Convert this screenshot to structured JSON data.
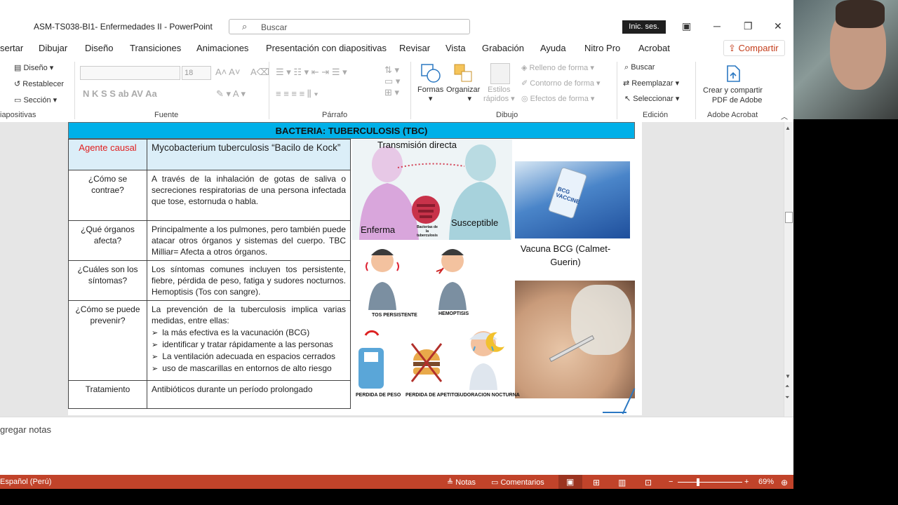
{
  "window": {
    "title": "ASM-TS038-BI1- Enfermedades II  -  PowerPoint",
    "search_placeholder": "Buscar",
    "signin": "Inic. ses."
  },
  "tabs": [
    "sertar",
    "Dibujar",
    "Diseño",
    "Transiciones",
    "Animaciones",
    "Presentación con diapositivas",
    "Revisar",
    "Vista",
    "Grabación",
    "Ayuda",
    "Nitro Pro",
    "Acrobat"
  ],
  "share_label": "Compartir",
  "ribbon": {
    "slides": {
      "design": "Diseño",
      "reset": "Restablecer",
      "section": "Sección",
      "group": "iapositivas"
    },
    "font": {
      "size": "18",
      "group": "Fuente"
    },
    "paragraph": {
      "group": "Párrafo"
    },
    "drawing": {
      "shapes": "Formas",
      "arrange": "Organizar",
      "quick1": "Estilos",
      "quick2": "rápidos",
      "fill": "Relleno de forma",
      "outline": "Contorno de forma",
      "effects": "Efectos de forma",
      "group": "Dibujo"
    },
    "editing": {
      "find": "Buscar",
      "replace": "Reemplazar",
      "select": "Seleccionar",
      "group": "Edición"
    },
    "adobe": {
      "l1": "Crear y compartir",
      "l2": "PDF de Adobe",
      "group": "Adobe Acrobat"
    }
  },
  "slide": {
    "banner": "BACTERIA: TUBERCULOSIS (TBC)",
    "rows": [
      {
        "q": "Agente causal",
        "a": "Mycobacterium tuberculosis “Bacilo de Kock”"
      },
      {
        "q": "¿Cómo se contrae?",
        "a": "A través de la inhalación de gotas de saliva o secreciones respiratorias de una persona infectada que tose, estornuda o habla."
      },
      {
        "q": "¿Qué órganos afecta?",
        "a": "Principalmente a los pulmones, pero también puede atacar otros órganos y sistemas del cuerpo. TBC Milliar= Afecta a otros órganos."
      },
      {
        "q": "¿Cuáles son los síntomas?",
        "a": "Los síntomas comunes incluyen tos persistente, fiebre, pérdida de peso, fatiga y sudores nocturnos. Hemoptisis (Tos con sangre)."
      },
      {
        "q": "¿Cómo se puede prevenir?",
        "a": "La prevención de la tuberculosis implica varias medidas, entre ellas:"
      },
      {
        "q": "Tratamiento",
        "a": "Antibióticos durante un período prolongado"
      }
    ],
    "prevention_items": [
      "la más efectiva es la vacunación (BCG)",
      "identificar y tratar rápidamente a las personas",
      "La ventilación adecuada en espacios cerrados",
      "uso de mascarillas en entornos de alto riesgo"
    ],
    "transmission_title": "Transmisión directa",
    "sick_label": "Enferma",
    "susceptible_label": "Susceptible",
    "bacteria_label": "Bacterias de la tuberculosis",
    "vaccine_text": "BCG VACCINE",
    "vaccine_caption": "Vacuna BCG (Calmet-Guerin)",
    "cough_label": "TOS PERSISTENTE",
    "hemoptysis_label": "HEMOPTISIS",
    "weight_label": "PERDIDA DE PESO",
    "appetite_label": "PERDIDA DE APETITO",
    "sweat_label": "SUDORACION NOCTURNA"
  },
  "notes_placeholder": "gregar notas",
  "status": {
    "language": "Español (Perú)",
    "notes": "Notas",
    "comments": "Comentarios",
    "zoom": "69%"
  }
}
